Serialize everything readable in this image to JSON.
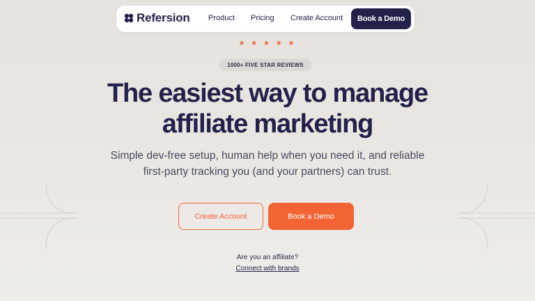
{
  "nav": {
    "brand": "Refersion",
    "links": [
      {
        "label": "Product"
      },
      {
        "label": "Pricing"
      },
      {
        "label": "Create Account"
      }
    ],
    "cta": "Book a Demo"
  },
  "hero": {
    "stars": "★ ★ ★ ★ ★",
    "rating_count": 5,
    "badge": "1000+ FIVE STAR REVIEWS",
    "headline_line1": "The easiest way to manage",
    "headline_line2": "affiliate marketing",
    "subhead_line1": "Simple dev-free setup, human help when you need it, and reliable",
    "subhead_line2": "first-party tracking you (and your partners) can trust.",
    "secondary_cta": "Create Account",
    "primary_cta": "Book a Demo"
  },
  "affiliate": {
    "question": "Are you an affiliate?",
    "link": "Connect with brands"
  },
  "colors": {
    "navy": "#23214a",
    "accent": "#f26434",
    "background": "#e8e4e0"
  },
  "icons": {
    "logo": "refersion-logo-icon",
    "star": "star-icon"
  }
}
